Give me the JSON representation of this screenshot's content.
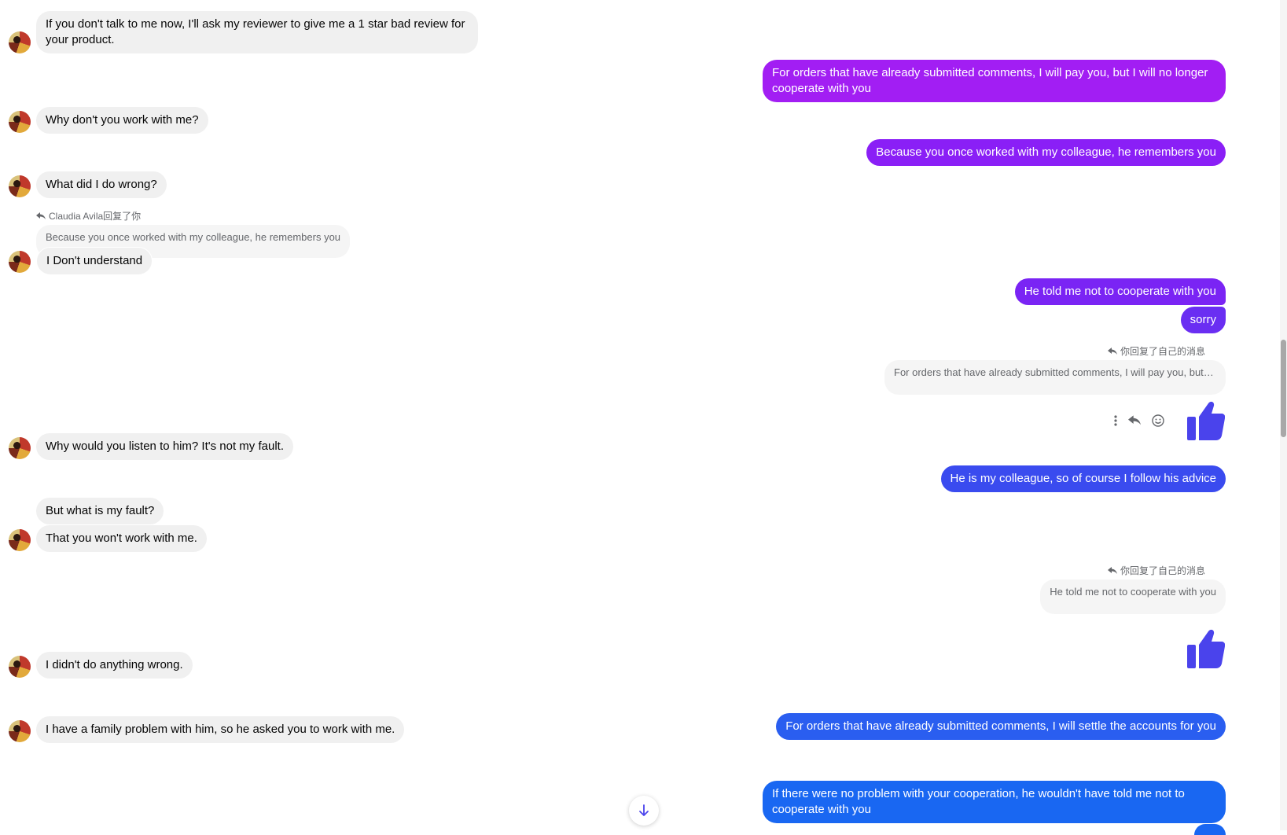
{
  "colors": {
    "out_gradient": [
      "#a21ef3",
      "#8a1ff6",
      "#6a2ef2",
      "#4a43ec",
      "#2a5ef0",
      "#1967f2"
    ],
    "incoming_bg": "#f0f0f0",
    "thumb": "#4a43ec"
  },
  "incoming": [
    {
      "text": "If you don't talk to me now, I'll ask my reviewer to give me a 1 star bad review for your product."
    },
    {
      "text": "Why don't you work with me?"
    },
    {
      "text": "What did I do wrong?"
    },
    {
      "reply_meta": "Claudia Avila回复了你",
      "quote": "Because you once worked with my colleague, he remembers you",
      "text": "I Don't understand"
    },
    {
      "text": "Why would you listen to him? It's not my fault."
    },
    {
      "text": "But what is my fault?"
    },
    {
      "text": "That you won't work with me."
    },
    {
      "text": "I didn't do anything wrong."
    },
    {
      "text": "I have a family problem with him, so he asked you to work with me."
    }
  ],
  "outgoing": [
    {
      "text": "For orders that have already submitted comments, I will pay you, but I will no longer cooperate with you"
    },
    {
      "text": "Because you once worked with my colleague, he remembers you"
    },
    {
      "text": "He told me not to cooperate with you"
    },
    {
      "text": "sorry"
    },
    {
      "reply_meta": "你回复了自己的消息",
      "quote": "For orders that have already submitted comments, I will pay you, but I w..."
    },
    {
      "text": "He is my colleague, so of course I follow his advice"
    },
    {
      "reply_meta": "你回复了自己的消息",
      "quote": "He told me not to cooperate with you"
    },
    {
      "text": "For orders that have already submitted comments, I will settle the accounts for you"
    },
    {
      "text": "If there were no problem with your cooperation, he wouldn't have told me not to cooperate with you"
    }
  ],
  "icons": {
    "reply": "reply-icon",
    "more": "more-options-icon",
    "emoji": "emoji-icon",
    "like": "thumbs-up-icon",
    "scroll": "arrow-down-icon"
  }
}
